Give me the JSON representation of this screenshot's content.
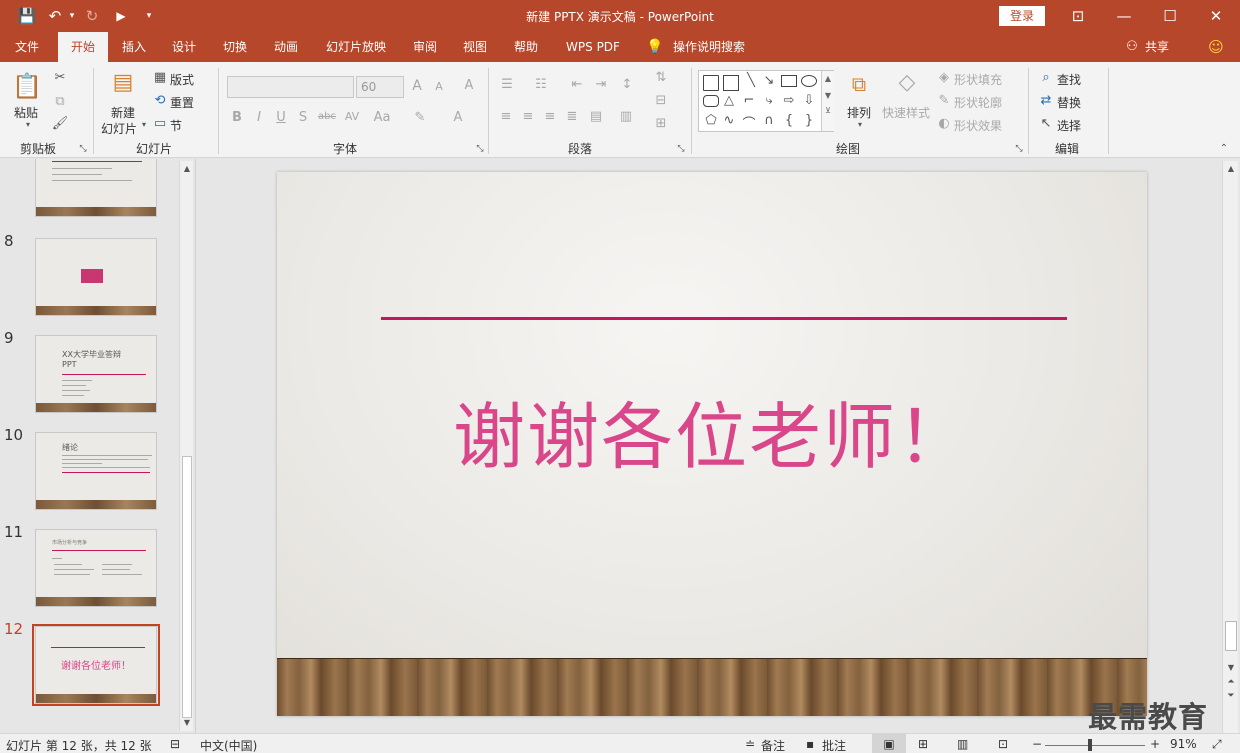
{
  "app": {
    "document_title": "新建 PPTX 演示文稿",
    "app_name": "PowerPoint",
    "login_label": "登录",
    "window_buttons": {
      "ribbon_display": "⊡",
      "minimize": "—",
      "maximize": "☐",
      "close": "✕"
    }
  },
  "quick_access": {
    "save": "💾",
    "undo": "↶",
    "undo_menu": "▾",
    "redo": "↻",
    "slideshow": "▶",
    "customize": "▾"
  },
  "tabs": [
    {
      "label": "文件",
      "active": false
    },
    {
      "label": "开始",
      "active": true
    },
    {
      "label": "插入",
      "active": false
    },
    {
      "label": "设计",
      "active": false
    },
    {
      "label": "切换",
      "active": false
    },
    {
      "label": "动画",
      "active": false
    },
    {
      "label": "幻灯片放映",
      "active": false
    },
    {
      "label": "审阅",
      "active": false
    },
    {
      "label": "视图",
      "active": false
    },
    {
      "label": "帮助",
      "active": false
    },
    {
      "label": "WPS PDF",
      "active": false
    }
  ],
  "tellme": {
    "icon": "lightbulb-icon",
    "label": "操作说明搜索"
  },
  "share": {
    "label": "共享",
    "icon": "person-icon"
  },
  "ribbon": {
    "clipboard": {
      "paste": "粘贴",
      "group_label": "剪贴板"
    },
    "slides": {
      "new_slide": "新建",
      "new_slide2": "幻灯片",
      "layout": "版式",
      "reset": "重置",
      "section": "节",
      "group_label": "幻灯片"
    },
    "font": {
      "font_name": "",
      "font_size": "60",
      "group_label": "字体",
      "bold": "B",
      "italic": "I",
      "underline": "U",
      "shadow": "S",
      "strike": "abc",
      "spacing": "AV",
      "case": "Aa",
      "color": "A",
      "grow": "A",
      "shrink": "A",
      "clear": "A"
    },
    "paragraph": {
      "group_label": "段落"
    },
    "drawing": {
      "arrange": "排列",
      "quick_styles": "快速样式",
      "shape_fill": "形状填充",
      "shape_outline": "形状轮廓",
      "shape_effects": "形状效果",
      "group_label": "绘图"
    },
    "editing": {
      "find": "查找",
      "replace": "替换",
      "select": "选择",
      "group_label": "编辑"
    }
  },
  "slides_panel": {
    "numbers": [
      "8",
      "9",
      "10",
      "11",
      "12"
    ],
    "thumb9_title": "XX大学毕业答辩PPT",
    "thumb10_title": "绪论",
    "thumb11_title": "市场分析与竞争",
    "thumb12_text": "谢谢各位老师！",
    "selected": "12"
  },
  "slide": {
    "headline": "谢谢各位老师！",
    "colors": {
      "accent_line": "#c2185b",
      "headline_text": "#d9478a"
    }
  },
  "watermark": "最需教育",
  "status_bar": {
    "slide_info": "幻灯片 第 12 张，共 12 张",
    "language": "中文(中国)",
    "notes": "备注",
    "comments": "批注",
    "zoom_value": 91,
    "zoom": "91%",
    "zoom_minus": "−",
    "zoom_plus": "+"
  },
  "theme_colors": {
    "titlebar": "#b7472a",
    "ribbon": "#f3f3f3",
    "panel": "#e6e6e6"
  }
}
